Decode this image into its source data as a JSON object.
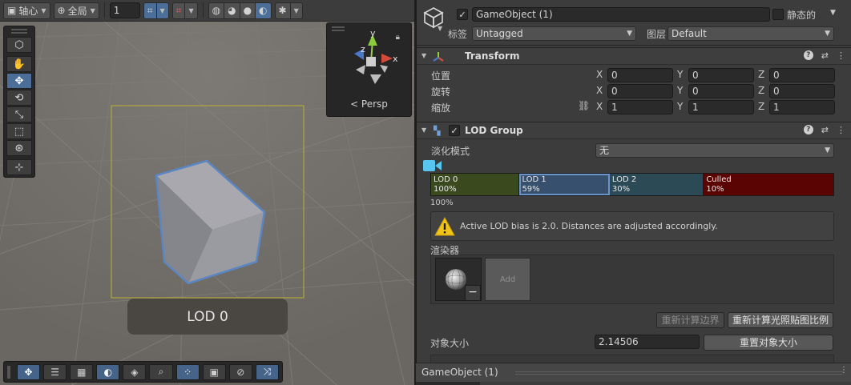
{
  "scene": {
    "toolbar": {
      "pivot_label": "轴心",
      "space_label": "全局",
      "grid_value": "1"
    },
    "gizmo": {
      "x_axis": "x",
      "y_axis": "y",
      "z_axis": "z",
      "persp_label": "< Persp"
    },
    "lod_label": "LOD 0"
  },
  "inspector": {
    "object_name": "GameObject (1)",
    "static_label": "静态的",
    "tag_label": "标签",
    "tag_value": "Untagged",
    "layer_label": "图层",
    "layer_value": "Default",
    "transform": {
      "title": "Transform",
      "position_label": "位置",
      "rotation_label": "旋转",
      "scale_label": "缩放",
      "position": {
        "x": "0",
        "y": "0",
        "z": "0"
      },
      "rotation": {
        "x": "0",
        "y": "0",
        "z": "0"
      },
      "scale": {
        "x": "1",
        "y": "1",
        "z": "1"
      },
      "axis_x": "X",
      "axis_y": "Y",
      "axis_z": "Z"
    },
    "lod_group": {
      "title": "LOD Group",
      "fade_mode_label": "淡化模式",
      "fade_mode_value": "无",
      "levels": [
        {
          "name": "LOD 0",
          "percent": "100%",
          "color": "#3b4a1e",
          "share": 22
        },
        {
          "name": "LOD 1",
          "percent": "59%",
          "color": "#37506d",
          "share": 22.4
        },
        {
          "name": "LOD 2",
          "percent": "30%",
          "color": "#2c4a55",
          "share": 23.4
        },
        {
          "name": "Culled",
          "percent": "10%",
          "color": "#5a0404",
          "share": 32.2
        }
      ],
      "camera_percent": "100%",
      "warning_text": "Active LOD bias is 2.0. Distances are adjusted accordingly.",
      "renderers_label": "渲染器",
      "add_label": "Add",
      "remove_label": "−",
      "recalc_bounds_label": "重新计算边界",
      "recalc_lightmap_label": "重新计算光照贴图比例",
      "object_size_label": "对象大小",
      "object_size_value": "2.14506",
      "reset_size_label": "重置对象大小"
    },
    "footer_title": "GameObject (1)"
  }
}
